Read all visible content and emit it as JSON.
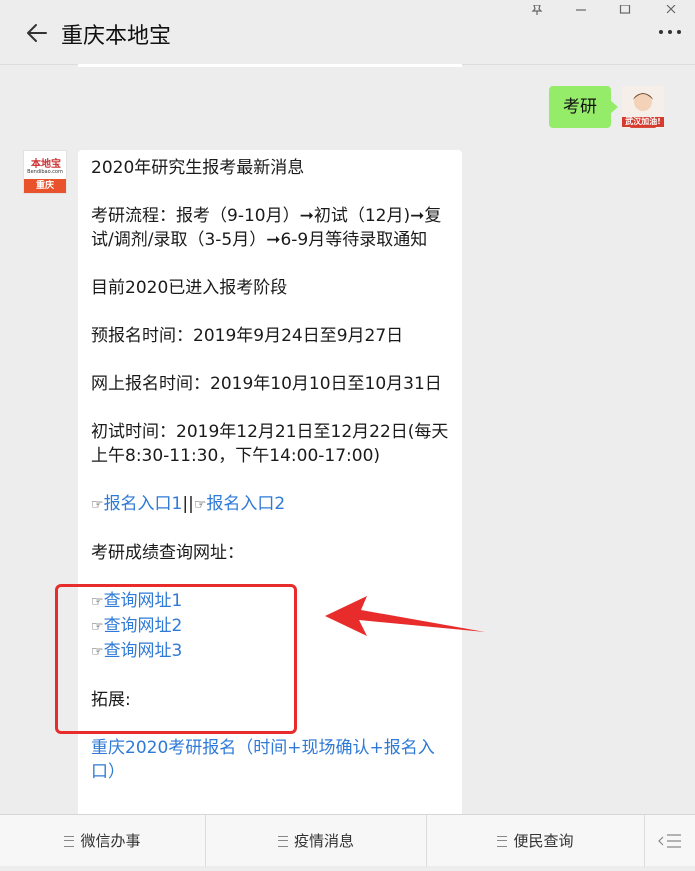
{
  "header": {
    "title": "重庆本地宝"
  },
  "user_message": {
    "text": "考研",
    "avatar_badge": "武汉加油!"
  },
  "bot": {
    "avatar_logo_text": "本地宝",
    "avatar_logo_url": "Bendibao.com",
    "avatar_city": "重庆"
  },
  "reply": {
    "heading": "2020年研究生报考最新消息",
    "process": "考研流程：报考（9-10月）➞初试（12月)➞复试/调剂/录取（3-5月）➞6-9月等待录取通知",
    "stage": "目前2020已进入报考阶段",
    "pre_register": "预报名时间：2019年9月24日至9月27日",
    "online_register": "网上报名时间：2019年10月10日至10月31日",
    "exam_time": "初试时间：2019年12月21日至12月22日(每天上午8:30-11:30，下午14:00-17:00)",
    "hand_glyph": "☞",
    "entry_link_1": "报名入口1",
    "entry_separator": "||",
    "entry_link_2": "报名入口2",
    "score_heading": "考研成绩查询网址：",
    "query_links": [
      "查询网址1",
      "查询网址2",
      "查询网址3"
    ],
    "extend_heading": "拓展:",
    "extend_link": "重庆2020考研报名（时间+现场确认+报名入口）"
  },
  "bottom_menu": {
    "items": [
      "微信办事",
      "疫情消息",
      "便民查询"
    ]
  },
  "colors": {
    "accent_green": "#95ec69",
    "link_blue": "#2f7ad6",
    "annotation_red": "#e82c2c"
  }
}
